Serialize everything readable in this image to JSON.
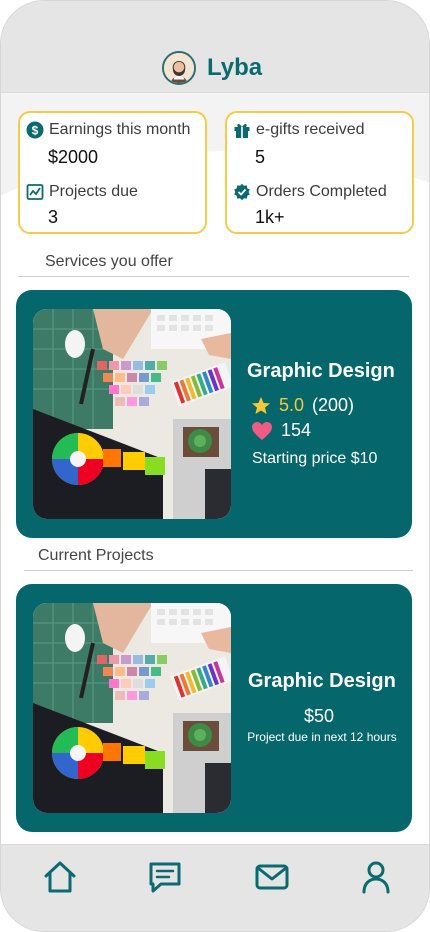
{
  "header": {
    "username": "Lyba",
    "avatar_icon": "user-avatar"
  },
  "stats": {
    "earnings": {
      "label": "Earnings this month",
      "value": "$2000",
      "icon": "dollar-icon"
    },
    "projects_due": {
      "label": "Projects due",
      "value": "3",
      "icon": "chart-icon"
    },
    "egifts": {
      "label": "e-gifts received",
      "value": "5",
      "icon": "gift-icon"
    },
    "orders": {
      "label": "Orders Completed",
      "value": "1k+",
      "icon": "verified-badge-icon"
    }
  },
  "sections": {
    "services_label": "Services you offer",
    "projects_label": "Current Projects"
  },
  "service_card": {
    "title": "Graphic Design",
    "rating": "5.0",
    "reviews": "(200)",
    "likes": "154",
    "price": "Starting price $10"
  },
  "project_card": {
    "title": "Graphic Design",
    "price": "$50",
    "due": "Project due in next 12 hours"
  },
  "nav": {
    "items": [
      "home-icon",
      "chat-icon",
      "mail-icon",
      "profile-icon"
    ]
  },
  "colors": {
    "brand": "#05676b",
    "accent": "#f2cc4a",
    "star": "#f5c83a",
    "heart": "#ef5b84"
  }
}
